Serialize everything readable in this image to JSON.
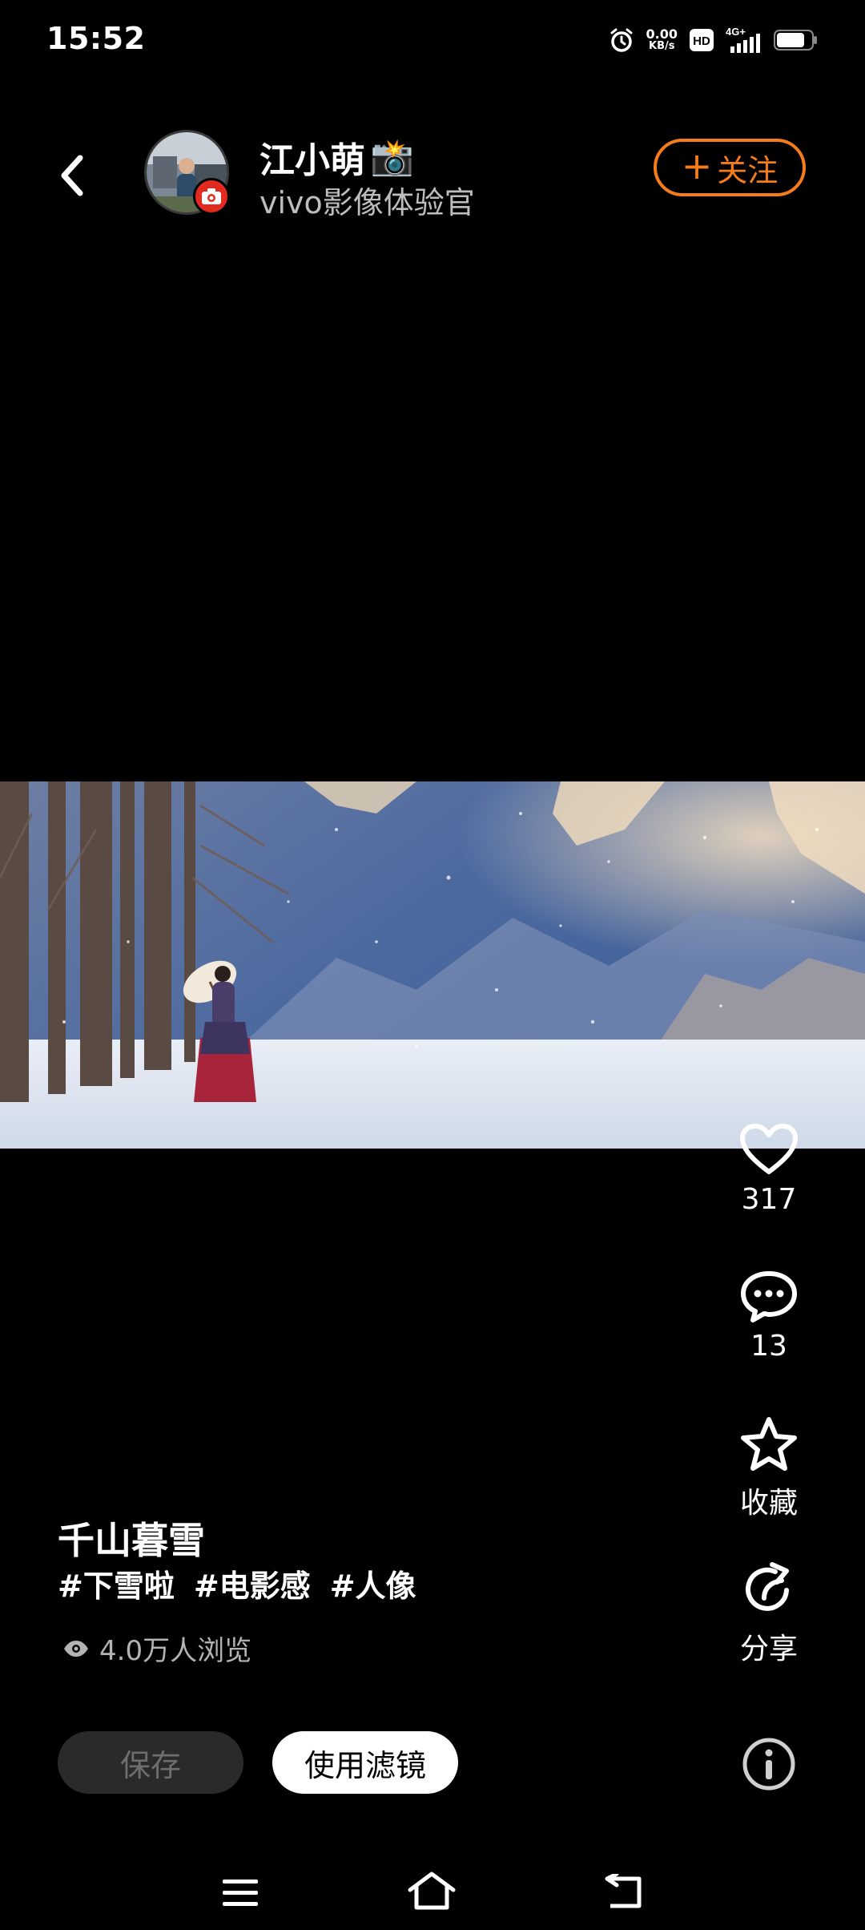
{
  "status_bar": {
    "time": "15:52",
    "net_speed_value": "0.00",
    "net_speed_unit": "KB/s",
    "network": "4G+",
    "icons": [
      "alarm-icon",
      "hd-icon",
      "signal-icon",
      "battery-icon"
    ]
  },
  "header": {
    "back_icon": "chevron-left-icon",
    "author_name": "江小萌",
    "author_emoji": "📸",
    "author_subtitle": "vivo影像体验官",
    "follow_label": "关注",
    "follow_plus": "+",
    "badge_icon": "camera-icon"
  },
  "actions": {
    "like_count": "317",
    "comment_count": "13",
    "collect_label": "收藏",
    "share_label": "分享",
    "icons": [
      "heart-icon",
      "comment-icon",
      "star-icon",
      "share-icon",
      "info-icon"
    ]
  },
  "post": {
    "title": "千山暮雪",
    "hashtags": [
      "#下雪啦",
      "#电影感",
      "#人像"
    ],
    "views": "4.0万人浏览"
  },
  "buttons": {
    "save_label": "保存",
    "use_filter_label": "使用滤镜"
  },
  "nav_bar": {
    "icons": [
      "menu-icon",
      "home-icon",
      "back-icon"
    ]
  },
  "colors": {
    "accent": "#f47c1b",
    "badge": "#e22a1f",
    "background": "#000000"
  }
}
